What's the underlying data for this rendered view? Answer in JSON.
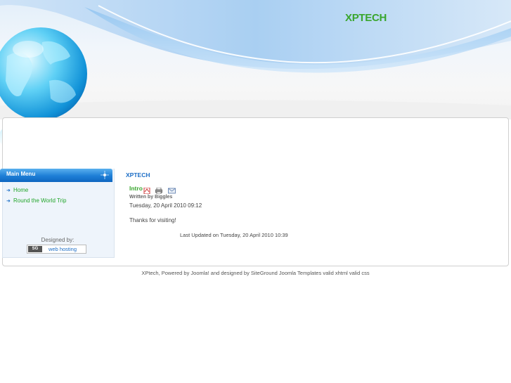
{
  "header": {
    "site_title": "XPTECH"
  },
  "sidebar": {
    "menu_title": "Main Menu",
    "items": [
      {
        "label": "Home"
      },
      {
        "label": "Round the World Trip"
      }
    ],
    "designed_by": "Designed by:",
    "hosting_link": "web hosting",
    "hosting_logo": "SG"
  },
  "content": {
    "section_title": "XPTECH",
    "article": {
      "title": "Intro",
      "author": "Written by Biggles",
      "date": "Tuesday, 20 April 2010 09:12",
      "body": "Thanks for visiting!",
      "updated": "Last Updated on Tuesday, 20 April 2010 10:39",
      "icons": [
        "pdf-icon",
        "print-icon",
        "email-icon"
      ]
    }
  },
  "footer": {
    "text": "XPtech, Powered by Joomla! and designed by SiteGround Joomla Templates valid xhtml valid css"
  },
  "colors": {
    "accent_green": "#3aa62e",
    "accent_blue": "#1d6ec6",
    "menu_header": "#1d7ed6"
  }
}
